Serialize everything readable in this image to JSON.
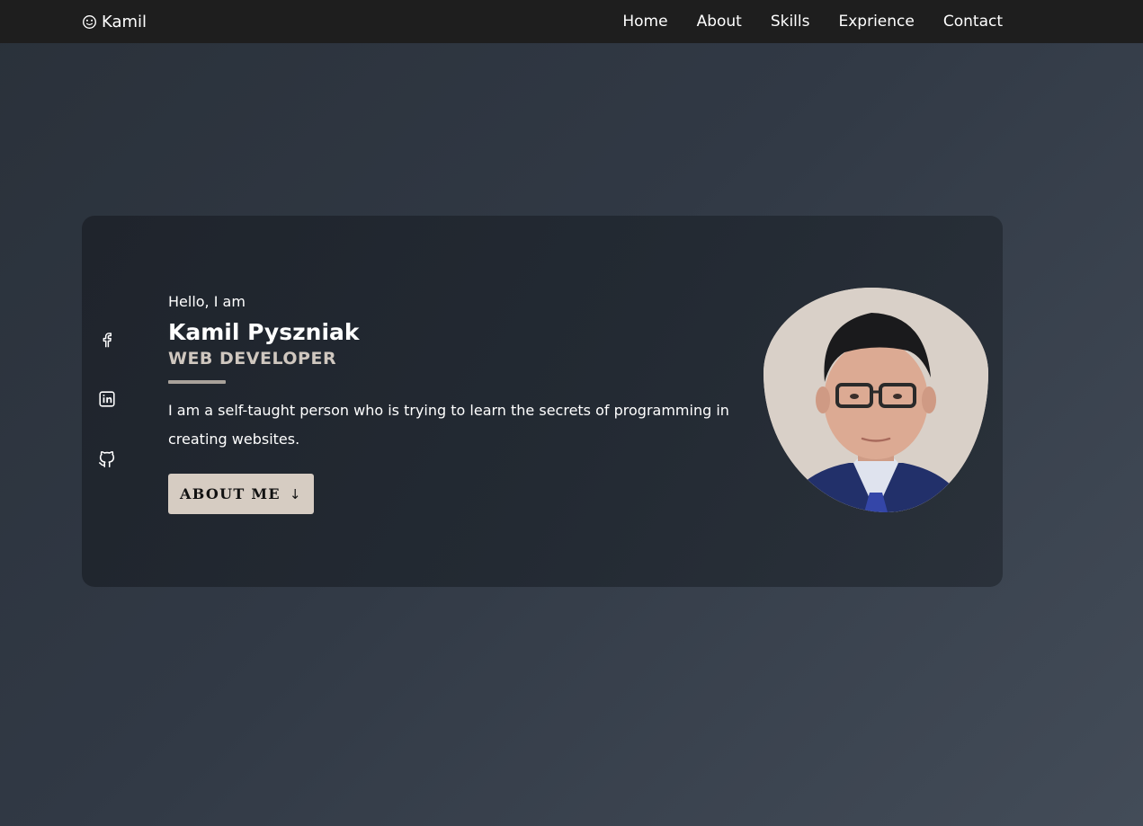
{
  "nav": {
    "brand": "Kamil",
    "brand_icon": "smiley-icon",
    "links": [
      "Home",
      "About",
      "Skills",
      "Exprience",
      "Contact"
    ]
  },
  "hero": {
    "greeting": "Hello, I am",
    "name": "Kamil Pyszniak",
    "role": "WEB DEVELOPER",
    "bio": "I am a self-taught person who is trying to learn the secrets of programming in creating websites.",
    "button_label": "ABOUT ME",
    "button_icon": "arrow-down-icon",
    "socials": [
      "facebook-icon",
      "linkedin-icon",
      "github-icon"
    ]
  },
  "colors": {
    "navbar_bg": "#1e1e1e",
    "accent": "#d6ccc2",
    "role_text": "#cfc7bf",
    "card_bg": "#20262e"
  }
}
